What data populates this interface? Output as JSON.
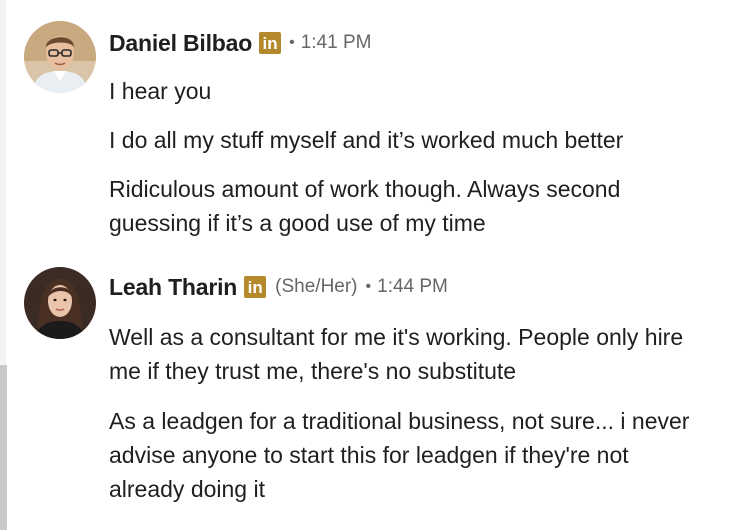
{
  "messages": [
    {
      "sender": "Daniel Bilbao",
      "badge": "in",
      "pronouns": "",
      "separator": "•",
      "time": "1:41 PM",
      "lines": [
        "I hear you",
        "I do all my stuff myself and it’s worked much better",
        "Ridiculous amount of work though. Always second guessing if it’s a good use of my time"
      ]
    },
    {
      "sender": "Leah Tharin",
      "badge": "in",
      "pronouns": "(She/Her)",
      "separator": "•",
      "time": "1:44 PM",
      "lines": [
        "Well as a consultant for me it's working. People only hire me if they trust me, there's no substitute",
        "As a leadgen for a traditional business, not sure... i never advise anyone to start this for leadgen if they're not already doing it"
      ]
    }
  ],
  "colors": {
    "badge": "#b3892c",
    "meta_text": "#666666",
    "body_text": "#1f1f1f"
  },
  "icons": {
    "badge_icon": "linkedin-badge-icon"
  }
}
